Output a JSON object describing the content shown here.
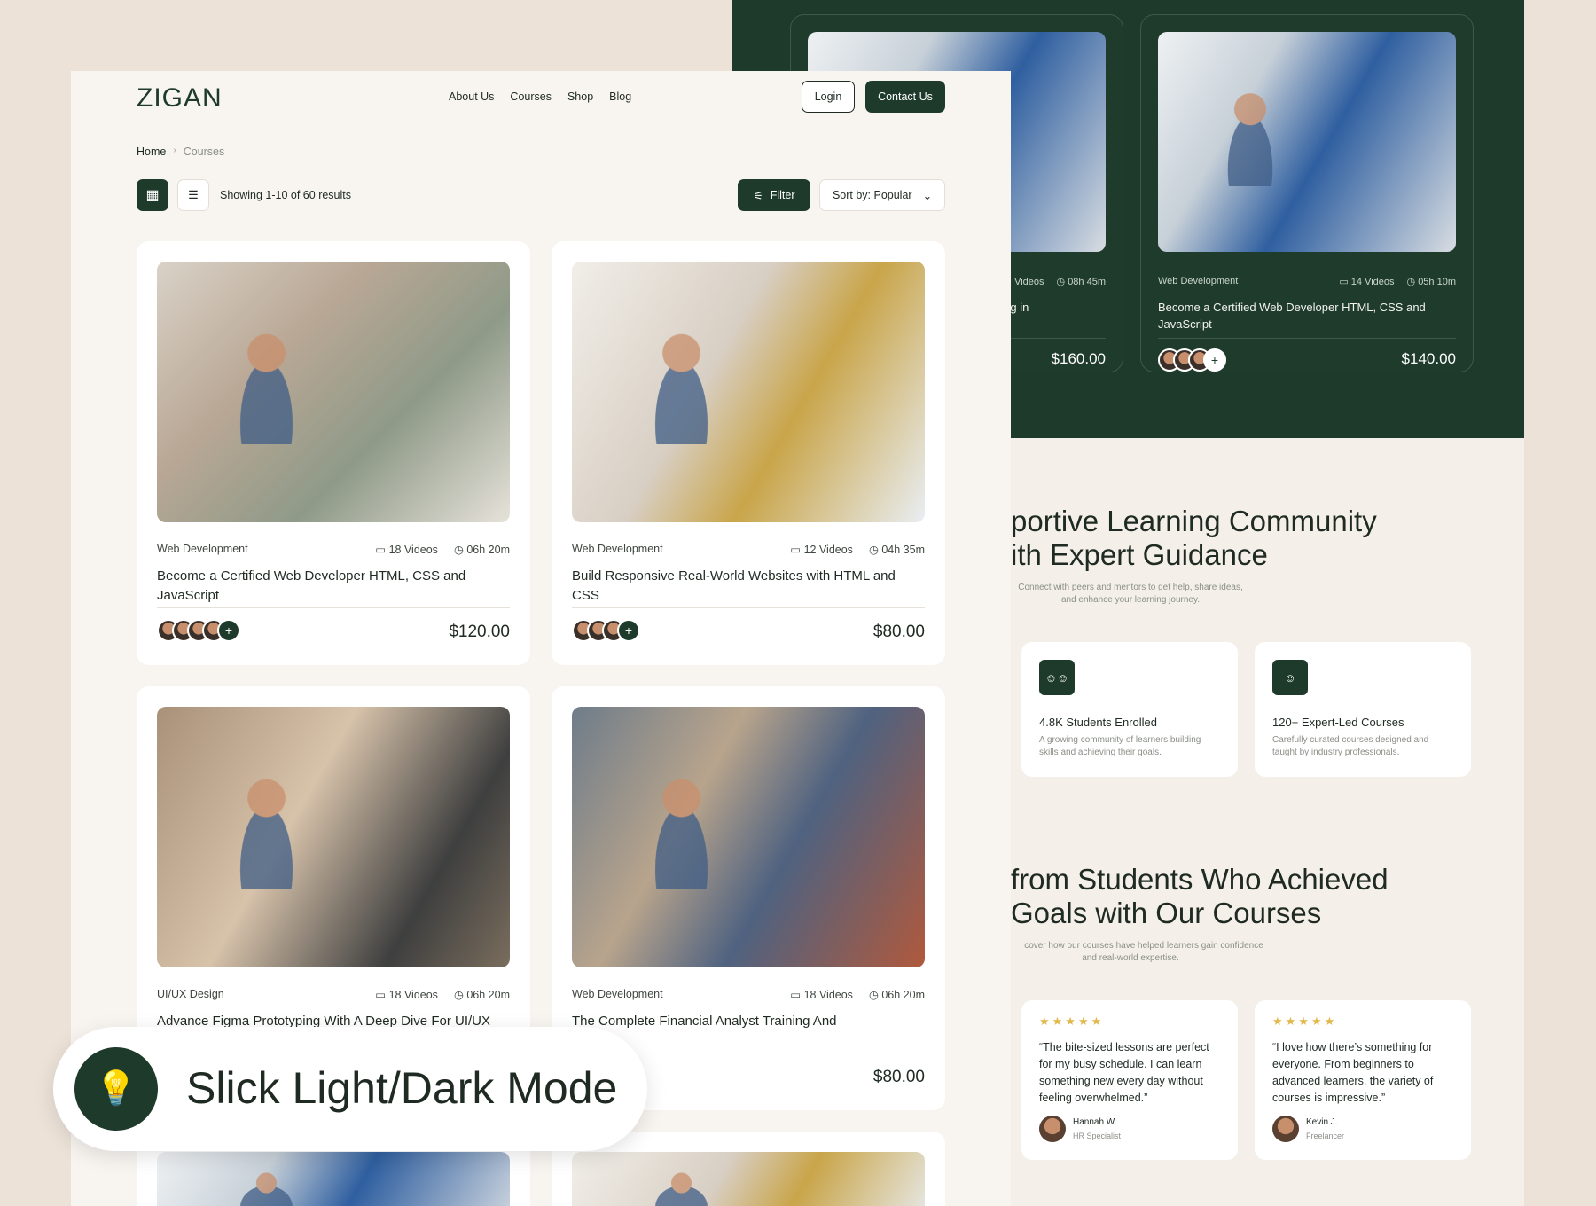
{
  "header": {
    "logo": "ZIGAN",
    "nav": [
      "About Us",
      "Courses",
      "Shop",
      "Blog"
    ],
    "login_label": "Login",
    "contact_label": "Contact Us"
  },
  "breadcrumb": {
    "home": "Home",
    "separator": "›",
    "current": "Courses"
  },
  "toolbar": {
    "results_text": "Showing 1-10 of 60 results",
    "filter_label": "Filter",
    "sort_label": "Sort by: Popular"
  },
  "courses": [
    {
      "category": "Web Development",
      "videos": "18 Videos",
      "duration": "06h 20m",
      "title": "Become a Certified Web Developer HTML, CSS and JavaScript",
      "price": "$120.00"
    },
    {
      "category": "Web Development",
      "videos": "12 Videos",
      "duration": "04h 35m",
      "title": "Build Responsive Real-World Websites with HTML and CSS",
      "price": "$80.00"
    },
    {
      "category": "UI/UX Design",
      "videos": "18 Videos",
      "duration": "06h 20m",
      "title": "Advance Figma Prototyping With A Deep Dive For UI/UX",
      "price": ""
    },
    {
      "category": "Web Development",
      "videos": "18 Videos",
      "duration": "06h 20m",
      "title": "The Complete Financial Analyst Training And",
      "price": "$80.00"
    }
  ],
  "dark_cards": [
    {
      "category": "",
      "videos": "Videos",
      "duration": "08h 45m",
      "title": "ding in",
      "price": "$160.00"
    },
    {
      "category": "Web Development",
      "videos": "14 Videos",
      "duration": "05h 10m",
      "title": "Become a Certified Web Developer HTML, CSS and JavaScript",
      "price": "$140.00"
    }
  ],
  "community": {
    "headline_1": "portive Learning Community",
    "headline_2": "ith Expert Guidance",
    "subtext_1": "Connect with peers and mentors to get help, share ideas,",
    "subtext_2": "and enhance your learning journey.",
    "features": [
      {
        "title": "4.8K Students Enrolled",
        "desc": "A growing community of learners building skills and achieving their goals."
      },
      {
        "title": "120+ Expert-Led Courses",
        "desc": "Carefully curated courses designed and taught by industry professionals."
      }
    ]
  },
  "testimonials": {
    "headline_1": "from Students Who Achieved",
    "headline_2": "Goals with Our Courses",
    "subtext_1": "cover how our courses have helped learners gain confidence",
    "subtext_2": "and real-world expertise.",
    "stars": "★★★★★",
    "reviews": [
      {
        "quote": "“The bite-sized lessons are perfect for my busy schedule. I can learn something new every day without feeling overwhelmed.”",
        "name": "Hannah W.",
        "role": "HR Specialist"
      },
      {
        "quote": "“I love how there’s something for everyone. From beginners to advanced learners, the variety of courses is impressive.”",
        "name": "Kevin J.",
        "role": "Freelancer"
      }
    ]
  },
  "badge": {
    "text": "Slick Light/Dark Mode",
    "icon": "lightbulb-icon"
  },
  "colors": {
    "dark_green": "#1e3a2b",
    "background": "#ece2d8",
    "star": "#e2b84a"
  }
}
